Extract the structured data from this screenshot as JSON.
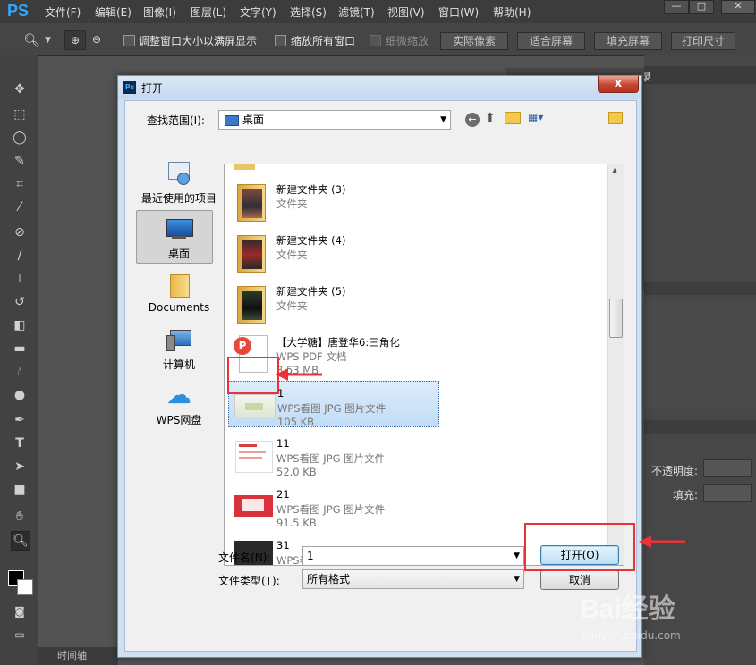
{
  "app": {
    "logo": "PS",
    "menu": [
      "文件(F)",
      "编辑(E)",
      "图像(I)",
      "图层(L)",
      "文字(Y)",
      "选择(S)",
      "滤镜(T)",
      "视图(V)",
      "窗口(W)",
      "帮助(H)"
    ],
    "window_controls": [
      "—",
      "□",
      "✕"
    ]
  },
  "options_bar": {
    "checkboxes": [
      "调整窗口大小以满屏显示",
      "缩放所有窗口",
      "细微缩放"
    ],
    "buttons": [
      "实际像素",
      "适合屏幕",
      "填充屏幕",
      "打印尺寸"
    ]
  },
  "right_panel": {
    "tab_label": "历史记录",
    "opacity_label": "不透明度:",
    "fill_label": "填充:"
  },
  "status_bar": {
    "timeline_tab": "时间轴"
  },
  "dialog": {
    "icon": "Ps",
    "title": "打开",
    "close": "x",
    "look_in_label": "查找范围(I):",
    "look_in_value": "桌面",
    "places": [
      {
        "label": "最近使用的项目",
        "icon": "recent-items-icon"
      },
      {
        "label": "桌面",
        "icon": "desktop-icon"
      },
      {
        "label": "Documents",
        "icon": "folder-icon"
      },
      {
        "label": "计算机",
        "icon": "computer-icon"
      },
      {
        "label": "WPS网盘",
        "icon": "cloud-icon"
      }
    ],
    "files": [
      {
        "name": "新建文件夹 (3)",
        "type": "文件夹",
        "size": "",
        "kind": "folder"
      },
      {
        "name": "新建文件夹 (4)",
        "type": "文件夹",
        "size": "",
        "kind": "folder"
      },
      {
        "name": "新建文件夹 (5)",
        "type": "文件夹",
        "size": "",
        "kind": "folder"
      },
      {
        "name": "【大学糖】唐登华6:三角化",
        "type": "WPS PDF 文档",
        "size": "3.53 MB",
        "kind": "pdf"
      },
      {
        "name": "1",
        "type": "WPS看图 JPG 图片文件",
        "size": "105 KB",
        "kind": "jpg-1",
        "selected": true
      },
      {
        "name": "11",
        "type": "WPS看图 JPG 图片文件",
        "size": "52.0 KB",
        "kind": "jpg-11"
      },
      {
        "name": "21",
        "type": "WPS看图 JPG 图片文件",
        "size": "91.5 KB",
        "kind": "jpg-21"
      },
      {
        "name": "31",
        "type": "WPS看图 JPG 图片文件",
        "size": "",
        "kind": "jpg-31"
      }
    ],
    "filename_label": "文件名(N):",
    "filename_value": "1",
    "filetype_label": "文件类型(T):",
    "filetype_value": "所有格式",
    "open_button": "打开(O)",
    "cancel_button": "取消"
  },
  "watermark": {
    "brand": "Bai经验",
    "url": "jingyan.baidu.com"
  },
  "colors": {
    "accent_red": "#e8333b",
    "selection": "#cce4f7",
    "ps_blue": "#31a8ff"
  }
}
